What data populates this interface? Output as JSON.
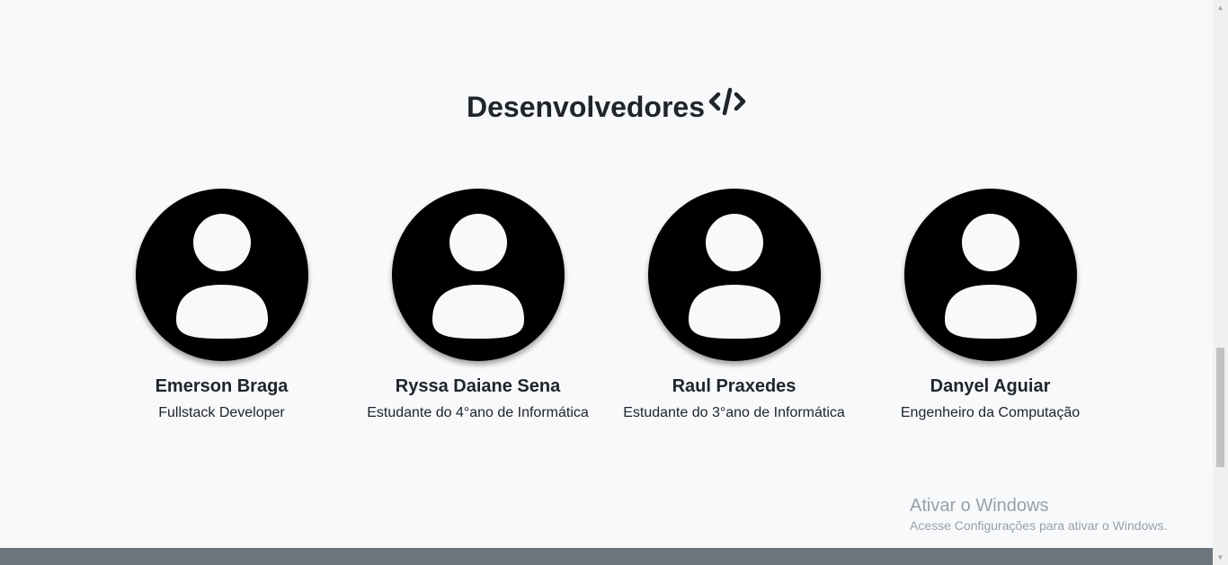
{
  "section": {
    "title": "Desenvolvedores",
    "title_icon": "code-icon"
  },
  "developers": [
    {
      "name": "Emerson Braga",
      "role": "Fullstack Developer",
      "avatar": "user-avatar-icon"
    },
    {
      "name": "Ryssa Daiane Sena",
      "role": "Estudante do 4°ano de Informática",
      "avatar": "user-avatar-icon"
    },
    {
      "name": "Raul Praxedes",
      "role": "Estudante do 3°ano de Informática",
      "avatar": "user-avatar-icon"
    },
    {
      "name": "Danyel Aguiar",
      "role": "Engenheiro da Computação",
      "avatar": "user-avatar-icon"
    }
  ],
  "watermark": {
    "title": "Ativar o Windows",
    "subtitle": "Acesse Configurações para ativar o Windows."
  },
  "colors": {
    "background": "#f7f9fb",
    "text": "#212529",
    "avatar": "#000000",
    "footer": "#6c757d",
    "watermark": "#9aa0a6"
  }
}
